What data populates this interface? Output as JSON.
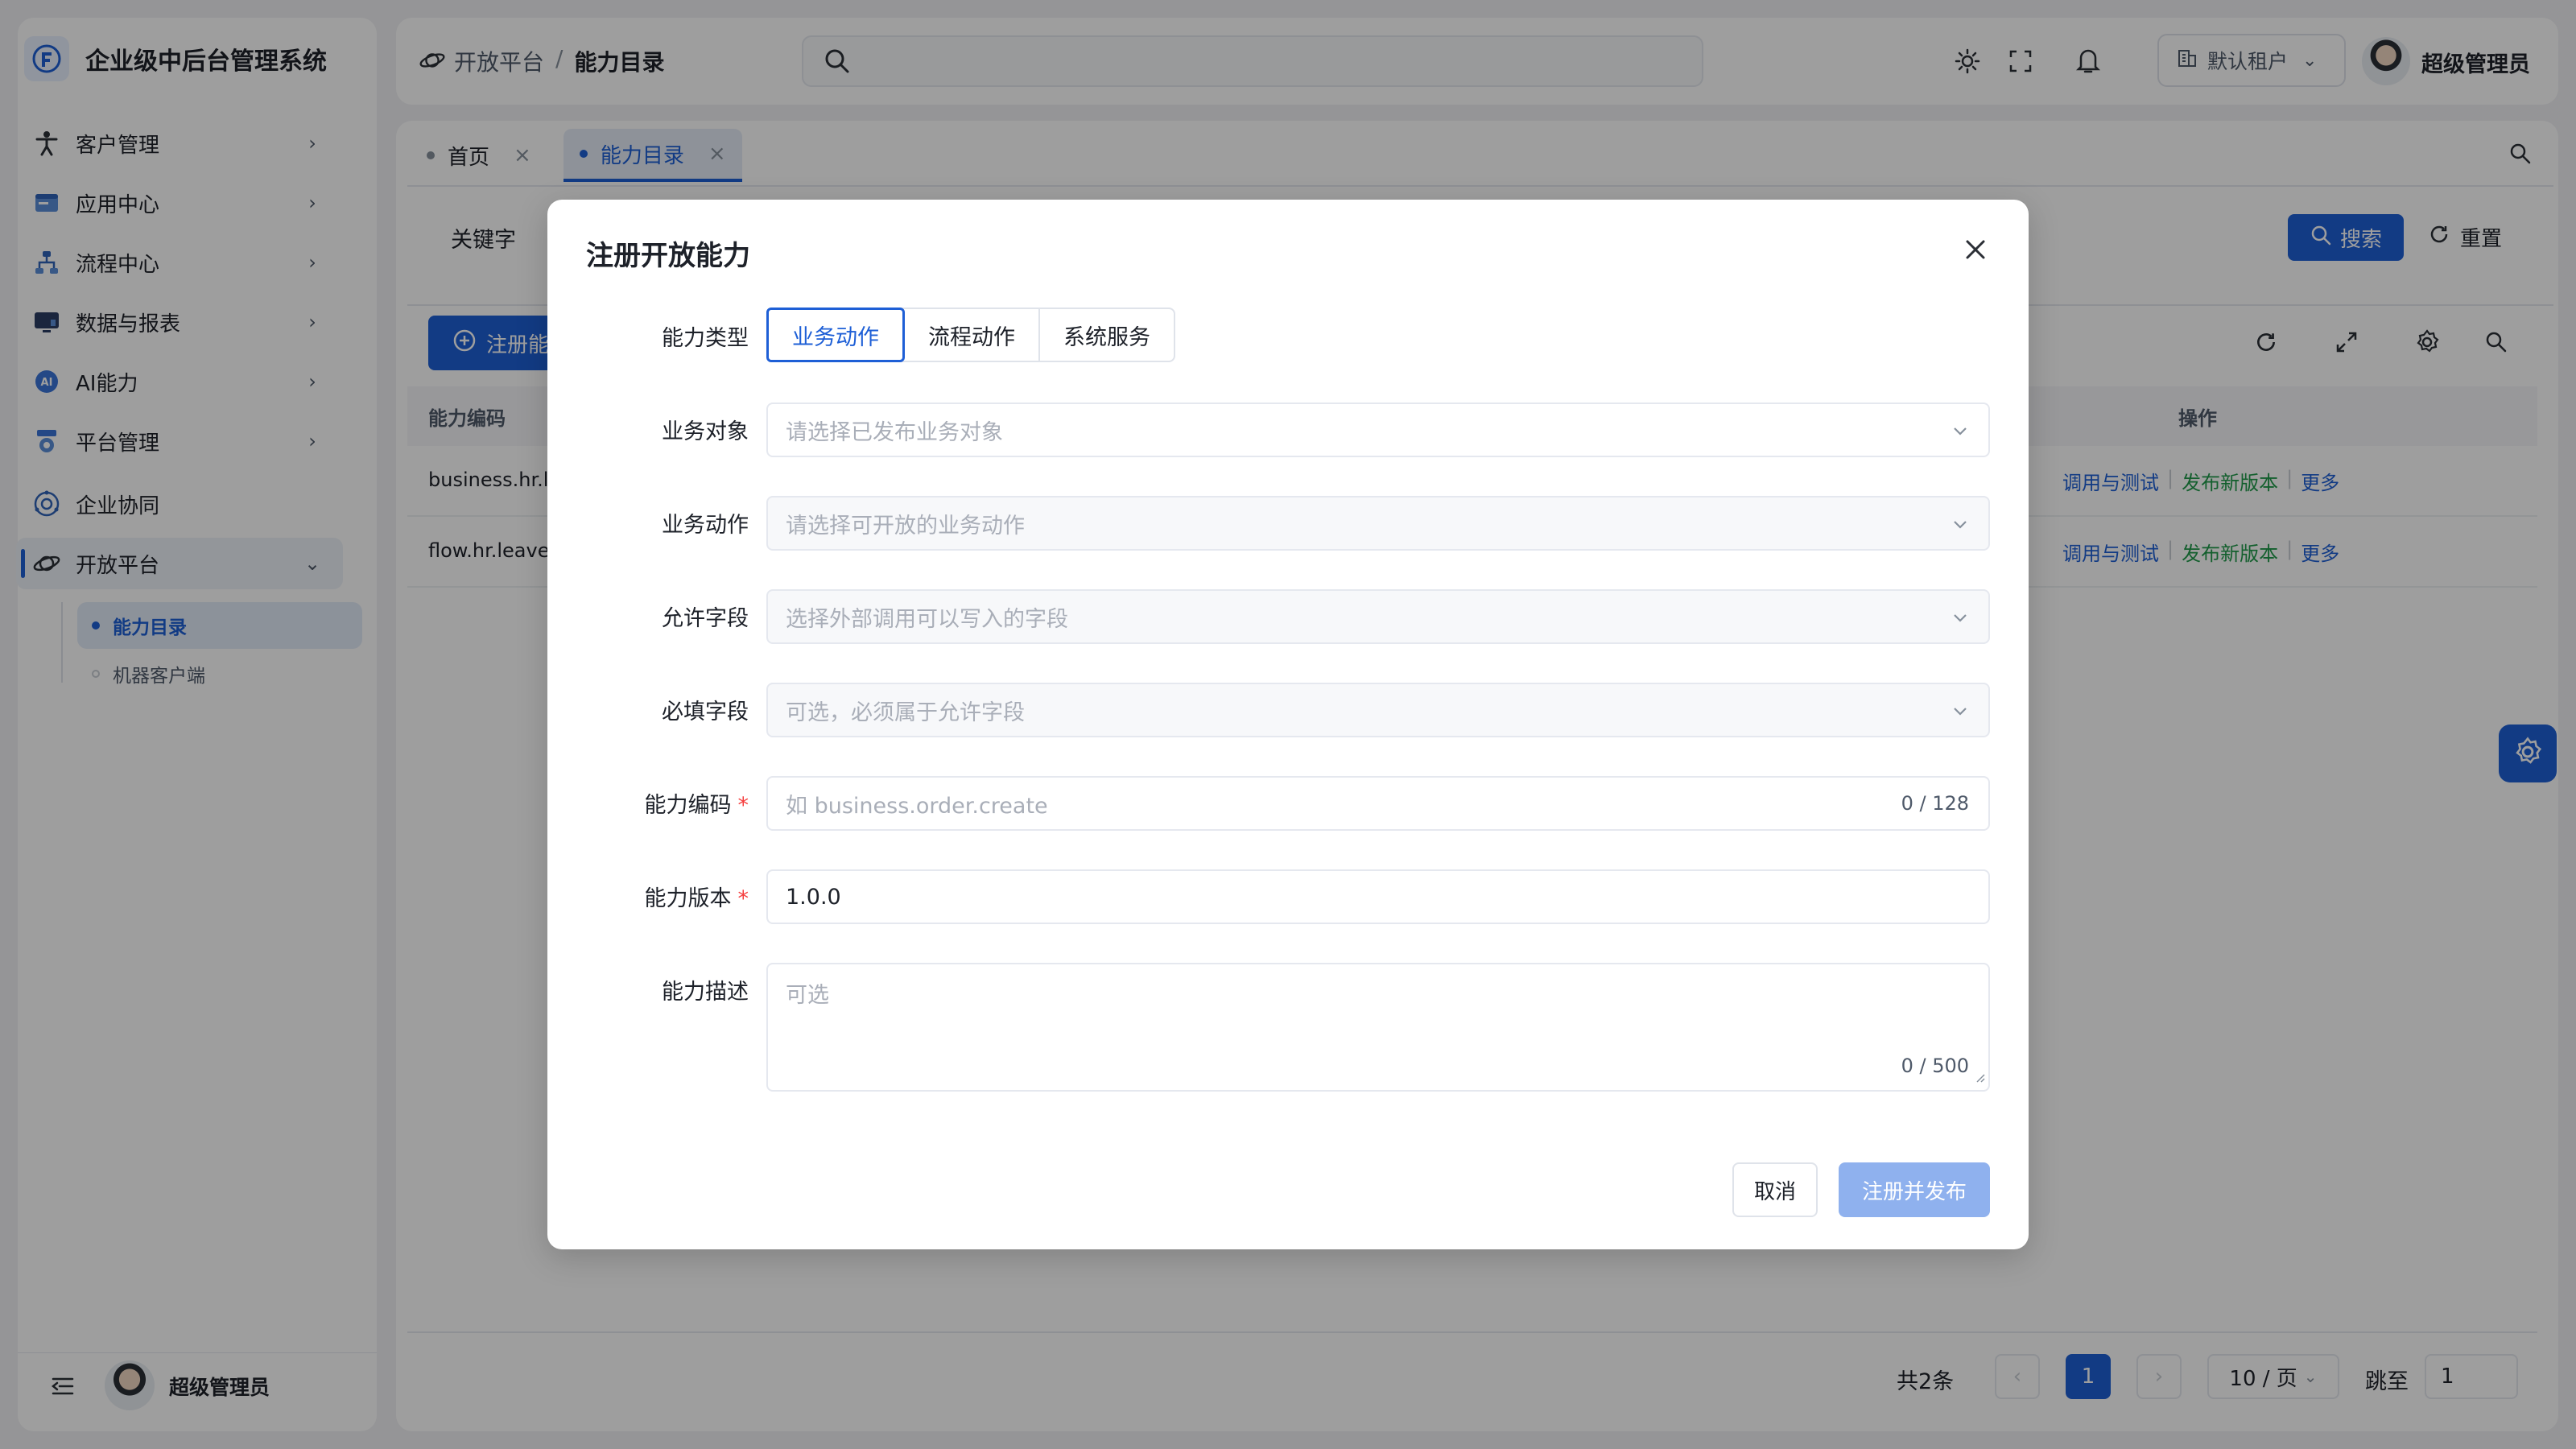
{
  "app": {
    "title": "企业级中后台管理系统"
  },
  "sidebar": {
    "items": [
      {
        "label": "客户管理",
        "icon": "person-figure-icon"
      },
      {
        "label": "应用中心",
        "icon": "app-window-icon"
      },
      {
        "label": "流程中心",
        "icon": "flow-icon"
      },
      {
        "label": "数据与报表",
        "icon": "monitor-chart-icon"
      },
      {
        "label": "AI能力",
        "icon": "ai-badge-icon"
      },
      {
        "label": "平台管理",
        "icon": "platform-icon"
      },
      {
        "label": "企业协同",
        "icon": "collaboration-icon"
      },
      {
        "label": "开放平台",
        "icon": "orbit-icon"
      }
    ],
    "subitems": [
      {
        "label": "能力目录",
        "active": true
      },
      {
        "label": "机器客户端",
        "active": false
      }
    ],
    "footer_user": "超级管理员"
  },
  "header": {
    "breadcrumb_root": "开放平台",
    "breadcrumb_sep": "/",
    "breadcrumb_current": "能力目录",
    "tenant": "默认租户",
    "user": "超级管理员"
  },
  "tabs": [
    {
      "label": "首页",
      "active": false
    },
    {
      "label": "能力目录",
      "active": true
    }
  ],
  "filters": {
    "keyword_label": "关键字",
    "search": "搜索",
    "reset": "重置"
  },
  "toolbar": {
    "register_label": "注册能力"
  },
  "table": {
    "col_code": "能力编码",
    "col_actions": "操作",
    "rows": [
      {
        "code": "business.hr.le",
        "a1": "调用与测试",
        "a2": "发布新版本",
        "a3": "更多"
      },
      {
        "code": "flow.hr.leave_",
        "a1": "调用与测试",
        "a2": "发布新版本",
        "a3": "更多"
      }
    ]
  },
  "pagination": {
    "total": "共2条",
    "current": "1",
    "page_size": "10 / 页",
    "jump_label": "跳至",
    "jump_value": "1"
  },
  "modal": {
    "title": "注册开放能力",
    "type_label": "能力类型",
    "type_options": [
      "业务动作",
      "流程动作",
      "系统服务"
    ],
    "fields": {
      "biz_object": {
        "label": "业务对象",
        "placeholder": "请选择已发布业务对象"
      },
      "biz_action": {
        "label": "业务动作",
        "placeholder": "请选择可开放的业务动作"
      },
      "allowed_fields": {
        "label": "允许字段",
        "placeholder": "选择外部调用可以写入的字段"
      },
      "required_fields": {
        "label": "必填字段",
        "placeholder": "可选，必须属于允许字段"
      },
      "code": {
        "label": "能力编码",
        "placeholder": "如 business.order.create",
        "count": "0 / 128"
      },
      "version": {
        "label": "能力版本",
        "value": "1.0.0"
      },
      "desc": {
        "label": "能力描述",
        "placeholder": "可选",
        "count": "0 / 500"
      }
    },
    "required_mark": "*",
    "cancel": "取消",
    "submit": "注册并发布"
  },
  "colors": {
    "primary": "#1e5fd6",
    "success_link": "#1f9a4a",
    "required": "#f53f3f",
    "submit_disabled": "#8fb1ee"
  }
}
